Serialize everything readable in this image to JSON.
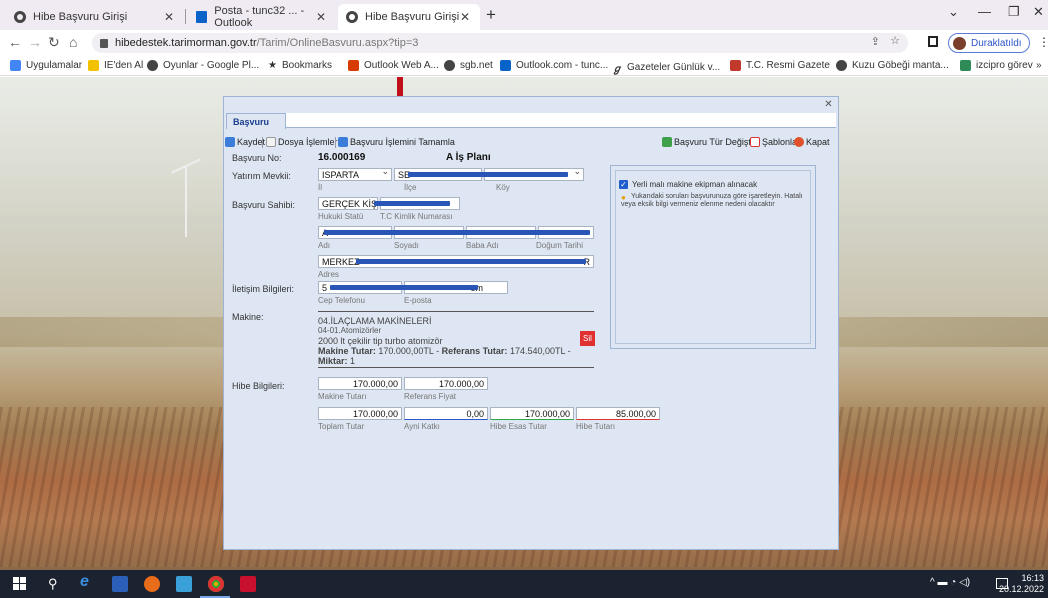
{
  "browser": {
    "tabs": [
      {
        "label": "Hibe Başvuru Girişi",
        "icon": "globe-icon",
        "active": false
      },
      {
        "label": "Posta - tunc32 ... - Outlook",
        "icon": "outlook-icon",
        "active": false
      },
      {
        "label": "Hibe Başvuru Girişi",
        "icon": "globe-icon",
        "active": true
      }
    ],
    "url_host": "hibedestek.tarimorman.gov.tr",
    "url_path": "/Tarim/OnlineBasvuru.aspx?tip=3",
    "profile_label": "Duraklatıldı",
    "bookmarks": [
      {
        "label": "Uygulamalar",
        "icon": "apps-icon",
        "color": "#4285f4"
      },
      {
        "label": "IE'den Al",
        "icon": "folder-icon",
        "color": "#f2c200"
      },
      {
        "label": "Oyunlar - Google Pl...",
        "icon": "globe-icon",
        "color": "#444444"
      },
      {
        "label": "Bookmarks",
        "icon": "star-icon",
        "color": "#222222"
      },
      {
        "label": "Outlook Web A...",
        "icon": "office-icon",
        "color": "#d83b01"
      },
      {
        "label": "sgb.net",
        "icon": "globe-icon",
        "color": "#444444"
      },
      {
        "label": "Outlook.com - tunc...",
        "icon": "outlook-icon",
        "color": "#0a64c8"
      },
      {
        "label": "Gazeteler Günlük v...",
        "icon": "gazete-icon",
        "color": "#444444"
      },
      {
        "label": "T.C. Resmi Gazete",
        "icon": "gazette-icon",
        "color": "#c0392b"
      },
      {
        "label": "Kuzu Göbeği manta...",
        "icon": "globe-icon",
        "color": "#444444"
      },
      {
        "label": "izcipro görev",
        "icon": "izci-icon",
        "color": "#2e8b57"
      }
    ]
  },
  "form": {
    "tab_label": "Başvuru",
    "toolbar": {
      "save": "Kaydet",
      "file_ops": "Dosya İşlemleri",
      "complete": "Başvuru İşlemini Tamamla",
      "change_type": "Başvuru Tür Değiştir",
      "templates": "Şablonlar",
      "close": "Kapat"
    },
    "application_no_label": "Başvuru No:",
    "application_no": "16.000169",
    "plan_label": "A İş Planı",
    "location_label": "Yatırım Mevkii:",
    "province": "ISPARTA",
    "district": "SE",
    "province_sub": "İl",
    "district_sub": "İlçe",
    "village_sub": "Köy",
    "owner_label": "Başvuru Sahibi:",
    "legal_status": "GERÇEK KİŞİ",
    "legal_status_sub": "Hukuki Statü",
    "tc_sub": "T.C Kimlik Numarası",
    "name_value": "A",
    "name_sub": "Adı",
    "surname_sub": "Soyadı",
    "father_sub": "Baba Adı",
    "birth_sub": "Doğum Tarihi",
    "address_value": "MERKEZ",
    "address_end": "R",
    "address_sub": "Adres",
    "contact_label": "İletişim Bilgileri:",
    "phone_value": "5",
    "email_end": "om",
    "phone_sub": "Cep Telefonu",
    "email_sub": "E-posta",
    "machine_label": "Makine:",
    "machine_category": "04.İLAÇLAMA MAKİNELERİ",
    "machine_sub": "04-01.Atomizörler",
    "machine_desc": "2000 lt çekilir tip turbo atomizör",
    "machine_total_label": "Makine Tutar:",
    "machine_total": "170.000,00TL",
    "reference_total_label": "Referans Tutar:",
    "reference_total": "174.540,00TL -",
    "quantity_label": "Miktar:",
    "quantity": "1",
    "delete_label": "Sil",
    "grant_label": "Hibe Bilgileri:",
    "machine_amount": "170.000,00",
    "machine_amount_sub": "Makine Tutarı",
    "reference_price": "170.000,00",
    "reference_price_sub": "Referans Fiyat",
    "total_amount": "170.000,00",
    "total_amount_sub": "Toplam Tutar",
    "in_kind": "0,00",
    "in_kind_sub": "Ayni Katkı",
    "grant_base": "170.000,00",
    "grant_base_sub": "Hibe Esas Tutar",
    "grant_amount": "85.000,00",
    "grant_amount_sub": "Hibe Tutarı",
    "info_check": "Yerli malı makine ekipman alınacak",
    "info_note": "Yukarıdaki soruları başvurunuza göre işaretleyin. Hatalı veya eksik bilgi vermeniz elenme nedeni olacaktır"
  },
  "taskbar": {
    "time": "16:13",
    "date": "20.12.2022"
  }
}
